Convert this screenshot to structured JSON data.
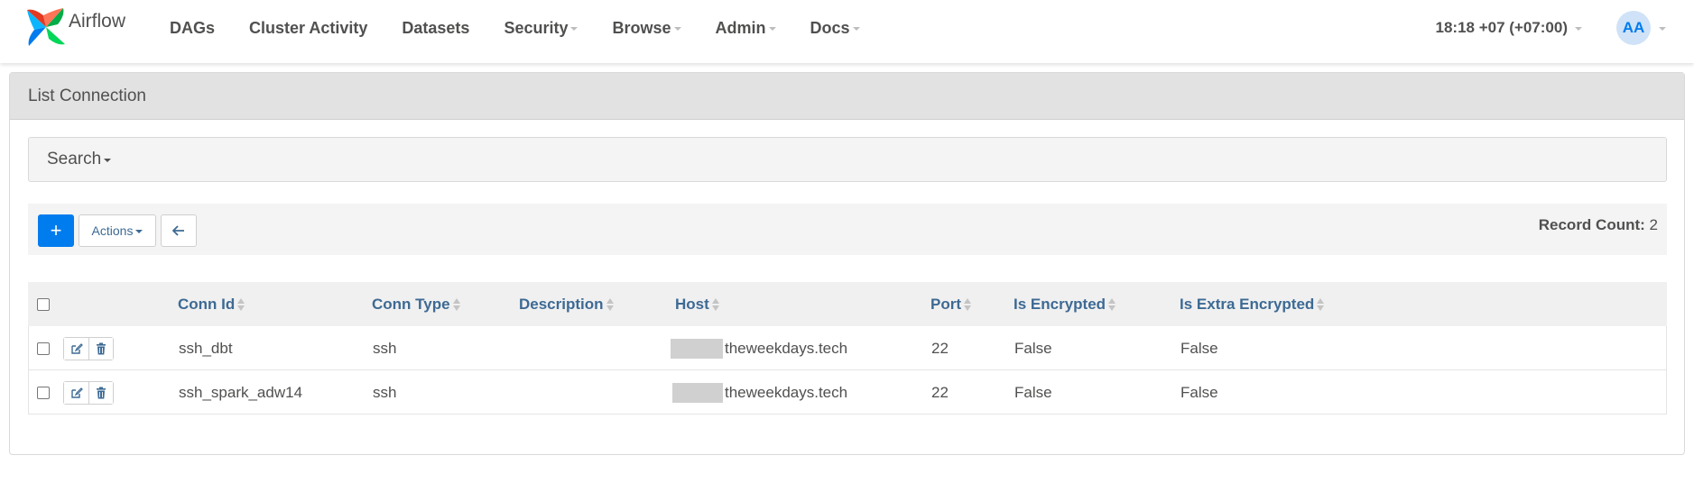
{
  "app": {
    "brand": "Airflow"
  },
  "nav": {
    "items": [
      {
        "label": "DAGs",
        "dropdown": false
      },
      {
        "label": "Cluster Activity",
        "dropdown": false
      },
      {
        "label": "Datasets",
        "dropdown": false
      },
      {
        "label": "Security",
        "dropdown": true
      },
      {
        "label": "Browse",
        "dropdown": true
      },
      {
        "label": "Admin",
        "dropdown": true
      },
      {
        "label": "Docs",
        "dropdown": true
      }
    ],
    "clock": "18:18 +07 (+07:00)",
    "avatar_initials": "AA"
  },
  "panel": {
    "title": "List Connection",
    "search_label": "Search",
    "toolbar": {
      "add_label": "+",
      "actions_label": "Actions",
      "record_count_label": "Record Count:",
      "record_count_value": "2"
    }
  },
  "table": {
    "headers": {
      "conn_id": "Conn Id",
      "conn_type": "Conn Type",
      "description": "Description",
      "host": "Host",
      "port": "Port",
      "is_encrypted": "Is Encrypted",
      "is_extra_encrypted": "Is Extra Encrypted"
    },
    "rows": [
      {
        "conn_id": "ssh_dbt",
        "conn_type": "ssh",
        "description": "",
        "host": "theweekdays.tech",
        "port": "22",
        "is_encrypted": "False",
        "is_extra_encrypted": "False"
      },
      {
        "conn_id": "ssh_spark_adw14",
        "conn_type": "ssh",
        "description": "",
        "host": "theweekdays.tech",
        "port": "22",
        "is_encrypted": "False",
        "is_extra_encrypted": "False"
      }
    ]
  },
  "colors": {
    "accent": "#017cee",
    "header_link": "#3d6a94",
    "text": "#51504f",
    "panel_heading": "#e2e2e2"
  }
}
